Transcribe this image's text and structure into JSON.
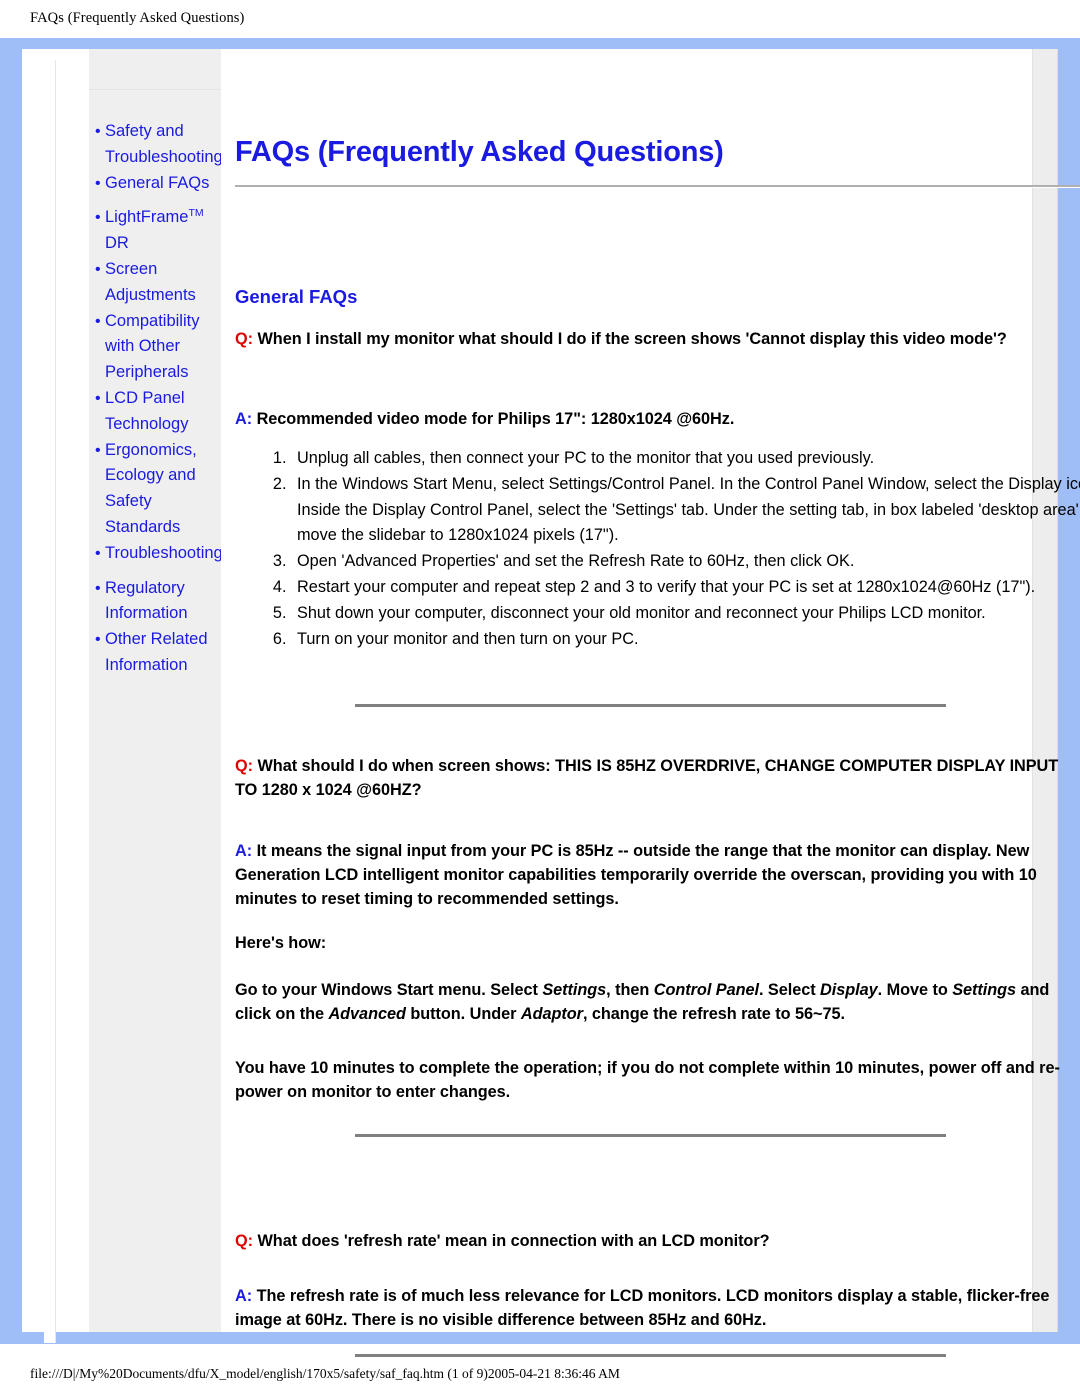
{
  "browser": {
    "print_header": "FAQs (Frequently Asked Questions)",
    "print_footer": "file:///D|/My%20Documents/dfu/X_model/english/170x5/safety/saf_faq.htm (1 of 9)2005-04-21 8:36:46 AM"
  },
  "colors": {
    "frame_blue": "#9fbdf7",
    "link_blue": "#1a1ae0",
    "q_red": "#e00000",
    "sidebar_gray": "#efefef",
    "rule_gray": "#808080"
  },
  "sidebar": {
    "items": [
      {
        "label": "Safety and Troubleshooting",
        "bullet": "•"
      },
      {
        "label": "General FAQs",
        "bullet": "•"
      },
      {
        "label": "LightFrame",
        "sup": "TM",
        "label_tail": " DR",
        "bullet": "•"
      },
      {
        "label": "Screen Adjustments",
        "bullet": "•"
      },
      {
        "label": "Compatibility with Other Peripherals",
        "bullet": "•"
      },
      {
        "label": "LCD Panel Technology",
        "bullet": "•"
      },
      {
        "label": "Ergonomics, Ecology and Safety Standards",
        "bullet": "•"
      },
      {
        "label": "Troubleshooting",
        "bullet": "•"
      },
      {
        "label": "Regulatory Information",
        "bullet": "•"
      },
      {
        "label": "Other Related Information",
        "bullet": "•"
      }
    ]
  },
  "main": {
    "page_title": "FAQs (Frequently Asked Questions)",
    "section_heading": "General FAQs",
    "qa": [
      {
        "q_marker": "Q:",
        "question": "When I install my monitor what should I do if the screen shows 'Cannot display this video mode'?",
        "a_marker": "A:",
        "answer": "Recommended video mode for Philips 17\": 1280x1024 @60Hz.",
        "steps": [
          "Unplug all cables, then connect your PC to the monitor that you used previously.",
          "In the Windows Start Menu, select Settings/Control Panel. In the Control Panel Window, select the Display icon. Inside the Display Control Panel, select the 'Settings' tab. Under the setting tab, in box labeled 'desktop area', move the slidebar to 1280x1024 pixels (17\").",
          "Open 'Advanced Properties' and set the Refresh Rate to 60Hz, then click OK.",
          "Restart your computer and repeat step 2 and 3 to verify that your PC is set at 1280x1024@60Hz (17\").",
          "Shut down your computer, disconnect your old monitor and reconnect your Philips LCD monitor.",
          "Turn on your monitor and then turn on your PC."
        ]
      },
      {
        "q_marker": "Q:",
        "question": "What should I do when screen shows: THIS IS 85HZ OVERDRIVE, CHANGE COMPUTER DISPLAY INPUT TO 1280 x 1024 @60HZ?",
        "a_marker": "A:",
        "answer": "It means the signal input from your PC is 85Hz -- outside the range that the monitor can display. New Generation LCD intelligent monitor capabilities temporarily override the overscan, providing you with 10 minutes to reset timing to recommended settings.",
        "heres_how_label": "Here's how:",
        "instructions_parts": [
          {
            "text": "Go to your Windows Start menu. Select "
          },
          {
            "text": "Settings",
            "italic": true
          },
          {
            "text": ", then "
          },
          {
            "text": "Control Panel",
            "italic": true
          },
          {
            "text": ". Select "
          },
          {
            "text": "Display",
            "italic": true
          },
          {
            "text": ". Move to "
          },
          {
            "text": "Settings",
            "italic": true
          },
          {
            "text": " and click on the "
          },
          {
            "text": "Advanced",
            "italic": true
          },
          {
            "text": " button. Under "
          },
          {
            "text": "Adaptor",
            "italic": true
          },
          {
            "text": ", change the refresh rate to 56~75."
          }
        ],
        "closing": "You have 10 minutes to complete the operation; if you do not complete within 10 minutes, power off and re-power on monitor to enter changes."
      },
      {
        "q_marker": "Q:",
        "question": "What does 'refresh rate' mean in connection with an LCD monitor?",
        "a_marker": "A:",
        "answer": "The refresh rate is of much less relevance for LCD monitors. LCD monitors display a stable, flicker-free image at 60Hz. There is no visible difference between 85Hz and 60Hz."
      }
    ]
  }
}
